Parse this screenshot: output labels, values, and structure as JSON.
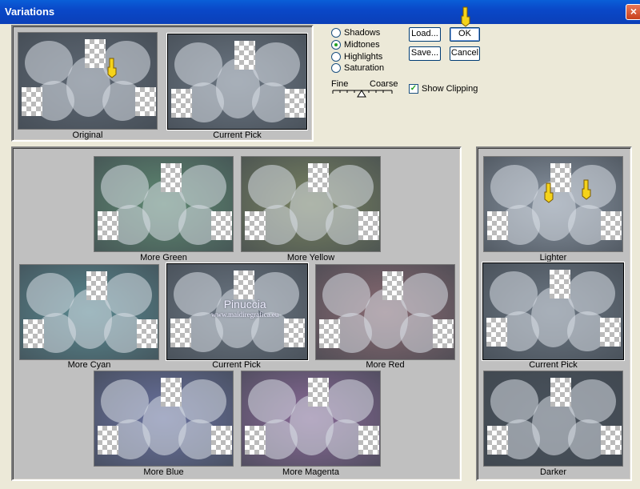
{
  "window": {
    "title": "Variations",
    "close_symbol": "×"
  },
  "top": {
    "original_label": "Original",
    "current_pick_label": "Current Pick"
  },
  "tones": [
    {
      "label": "Shadows",
      "selected": false
    },
    {
      "label": "Midtones",
      "selected": true
    },
    {
      "label": "Highlights",
      "selected": false
    },
    {
      "label": "Saturation",
      "selected": false
    }
  ],
  "slider": {
    "fine_label": "Fine",
    "coarse_label": "Coarse"
  },
  "buttons": {
    "load": "Load...",
    "ok": "OK",
    "save": "Save...",
    "cancel": "Cancel"
  },
  "show_clipping": {
    "label": "Show Clipping",
    "checked": true,
    "mark": "✓"
  },
  "color_grid": {
    "more_green": "More Green",
    "more_yellow": "More Yellow",
    "more_cyan": "More Cyan",
    "current_pick": "Current Pick",
    "more_red": "More Red",
    "more_blue": "More Blue",
    "more_magenta": "More Magenta"
  },
  "lightness": {
    "lighter": "Lighter",
    "current_pick": "Current Pick",
    "darker": "Darker"
  },
  "watermark": {
    "name": "Pinuccia",
    "url": "www.maidiregrafica.eu"
  },
  "colors": {
    "original": "#5f6975",
    "current": "#6c7783",
    "green": "#5f8a72",
    "yellow": "#7a8462",
    "cyan": "#5a8a91",
    "red": "#8a6a72",
    "blue": "#6a72a0",
    "magenta": "#8a6a98",
    "lighter": "#8a95a2",
    "darker": "#4a535d"
  }
}
